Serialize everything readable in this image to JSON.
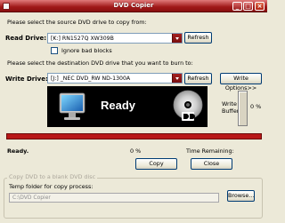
{
  "window": {
    "title": "DVD Copier",
    "minimize_label": "_",
    "maximize_label": "□",
    "close_label": "×"
  },
  "source": {
    "instruction": "Please select the source DVD drive to copy from:",
    "label": "Read Drive:",
    "selected_value": "[K:] RN1527Q  XW309B",
    "refresh_label": "Refresh",
    "ignore_bad_blocks_label": "Ignore bad blocks",
    "ignore_bad_blocks_checked": false
  },
  "destination": {
    "instruction": "Please select the destination DVD drive that you want to burn to:",
    "label": "Write Drive:",
    "selected_value": "[J:] _NEC     DVD_RW ND-1300A",
    "refresh_label": "Refresh",
    "write_options_label": "Write Options>>"
  },
  "banner": {
    "status_text": "Ready",
    "icons": [
      "monitor-icon",
      "dvd-disc-icon"
    ]
  },
  "buffer": {
    "label_line1": "Write",
    "label_line2": "Buffer",
    "percent_text": "0 %",
    "level": 0
  },
  "progress": {
    "status": "Ready.",
    "percent_text": "0 %",
    "time_remaining_label": "Time Remaining:",
    "level": 0,
    "color": "#b81818"
  },
  "actions": {
    "copy_label": "Copy",
    "close_label": "Close"
  },
  "blank_disc": {
    "group_title": "Copy DVD to a blank DVD disc",
    "temp_folder_label": "Temp folder for copy process:",
    "temp_folder_value": "C:\\DVD Copier",
    "browse_label": "Browse..."
  },
  "colors": {
    "title_bar": "#a01818",
    "accent": "#b81818",
    "window_bg": "#ece9d8"
  }
}
